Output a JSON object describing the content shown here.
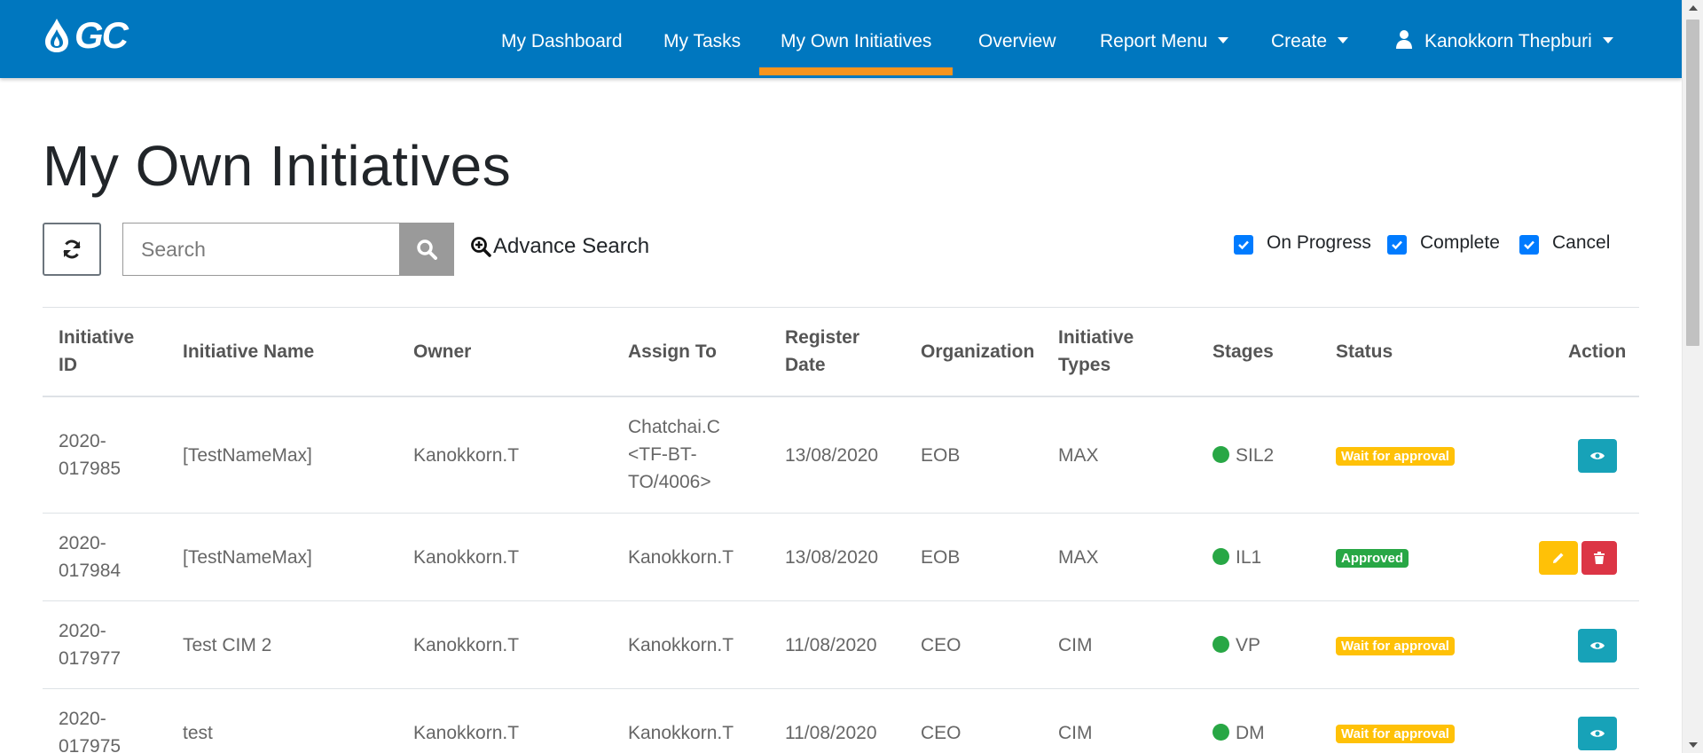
{
  "nav": {
    "logo_text": "GC",
    "items": [
      {
        "label": "My Dashboard"
      },
      {
        "label": "My Tasks"
      },
      {
        "label": "My Own Initiatives"
      },
      {
        "label": "Overview"
      },
      {
        "label": "Report Menu"
      },
      {
        "label": "Create"
      }
    ],
    "user_name": "Kanokkorn Thepburi"
  },
  "page_title": "My Own Initiatives",
  "toolbar": {
    "search_placeholder": "Search",
    "advance_search_label": "Advance Search",
    "filters": [
      {
        "label": "On Progress",
        "checked": true
      },
      {
        "label": "Complete",
        "checked": true
      },
      {
        "label": "Cancel",
        "checked": true
      }
    ]
  },
  "table": {
    "headers": {
      "id": "Initiative ID",
      "name": "Initiative Name",
      "owner": "Owner",
      "assign": "Assign To",
      "date": "Register Date",
      "org": "Organization",
      "types": "Initiative Types",
      "stages": "Stages",
      "status": "Status",
      "action": "Action"
    },
    "rows": [
      {
        "id": "2020-017985",
        "name": "[TestNameMax]",
        "owner": "Kanokkorn.T",
        "assign": "Chatchai.C <TF-BT-TO/4006>",
        "date": "13/08/2020",
        "org": "EOB",
        "type": "MAX",
        "stage": "SIL2",
        "status": "Wait for approval",
        "actions": [
          "view"
        ]
      },
      {
        "id": "2020-017984",
        "name": "[TestNameMax]",
        "owner": "Kanokkorn.T",
        "assign": "Kanokkorn.T",
        "date": "13/08/2020",
        "org": "EOB",
        "type": "MAX",
        "stage": "IL1",
        "status": "Approved",
        "actions": [
          "edit",
          "delete"
        ]
      },
      {
        "id": "2020-017977",
        "name": "Test CIM 2",
        "owner": "Kanokkorn.T",
        "assign": "Kanokkorn.T",
        "date": "11/08/2020",
        "org": "CEO",
        "type": "CIM",
        "stage": "VP",
        "status": "Wait for approval",
        "actions": [
          "view"
        ]
      },
      {
        "id": "2020-017975",
        "name": "test",
        "owner": "Kanokkorn.T",
        "assign": "Kanokkorn.T",
        "date": "11/08/2020",
        "org": "CEO",
        "type": "CIM",
        "stage": "DM",
        "status": "Wait for approval",
        "actions": [
          "view"
        ]
      }
    ]
  },
  "colors": {
    "navbar": "#0077bf",
    "active_underline": "#f7941d",
    "stage_dot": "#28a745",
    "badge_wait": "#ffc107",
    "badge_approved": "#28a745",
    "view_button": "#17a2b8",
    "edit_button": "#ffc107",
    "delete_button": "#dc3545"
  }
}
